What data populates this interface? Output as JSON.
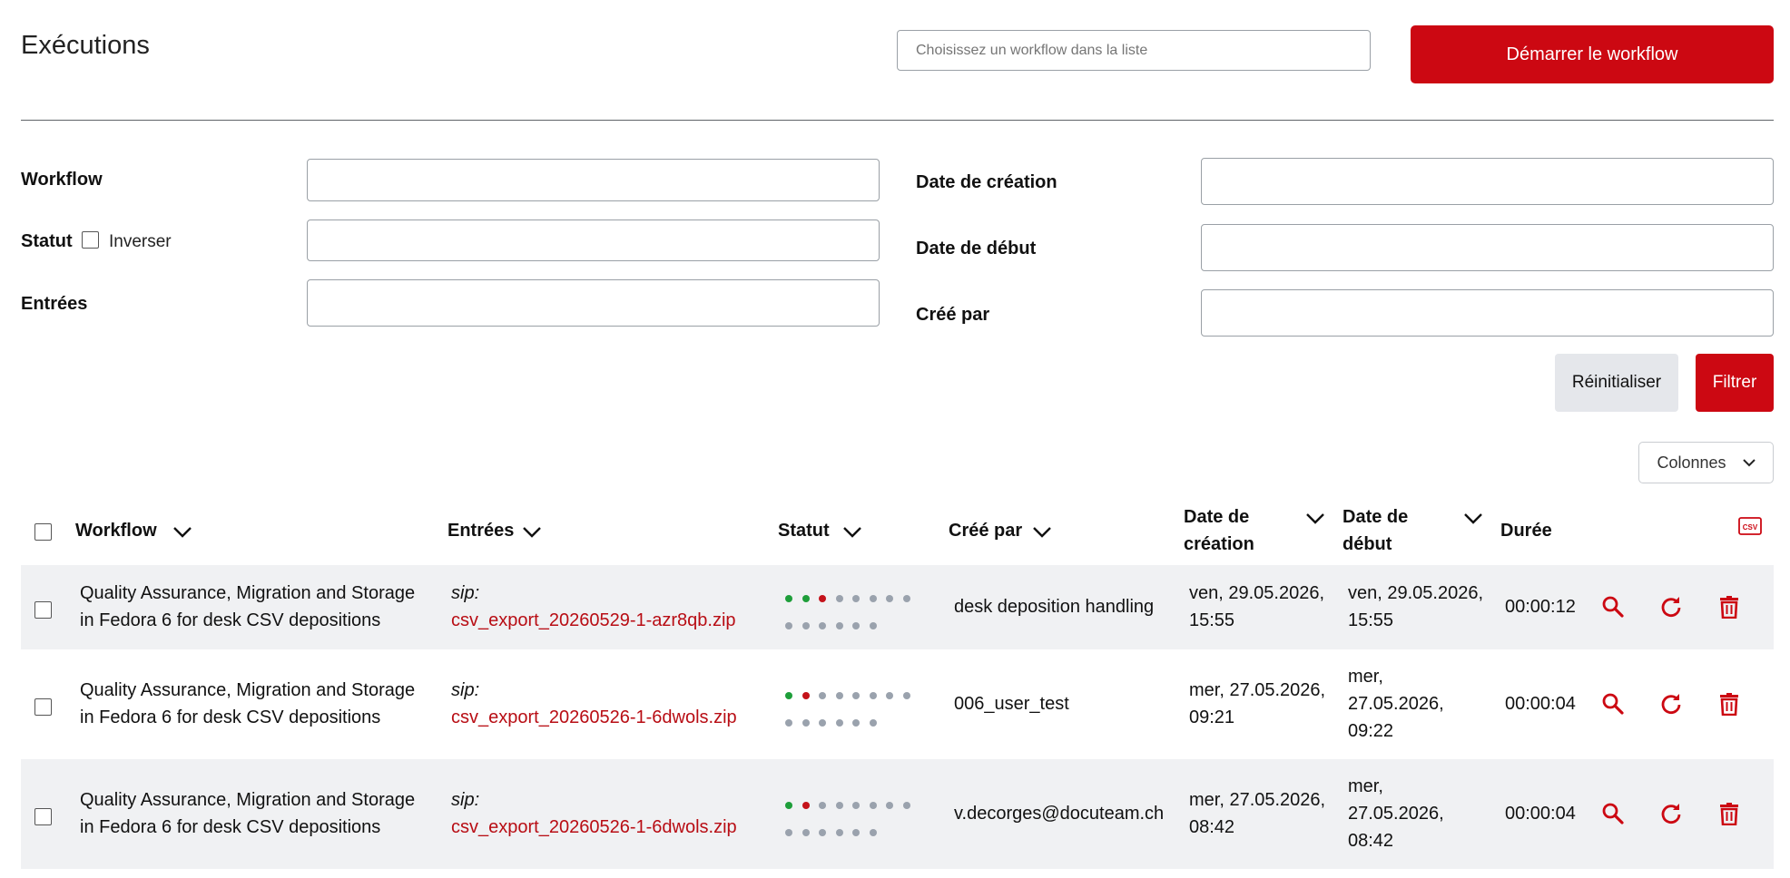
{
  "header": {
    "title": "Exécutions",
    "workflow_select_placeholder": "Choisissez un workflow dans la liste",
    "start_button": "Démarrer le workflow"
  },
  "filters": {
    "workflow_label": "Workflow",
    "status_label": "Statut",
    "invert_label": "Inverser",
    "inputs_label": "Entrées",
    "created_date_label": "Date de création",
    "start_date_label": "Date de début",
    "created_by_label": "Créé par",
    "reset_button": "Réinitialiser",
    "filter_button": "Filtrer"
  },
  "columns_button": "Colonnes",
  "table": {
    "headers": {
      "workflow": "Workflow",
      "inputs": "Entrées",
      "status": "Statut",
      "created_by": "Créé par",
      "created_date_1": "Date de",
      "created_date_2": "création",
      "start_date_1": "Date de",
      "start_date_2": "début",
      "duration": "Durée"
    },
    "rows": [
      {
        "workflow_1": "Quality Assurance, Migration and Storage",
        "workflow_2": "in Fedora 6 for desk CSV depositions",
        "input_type": "sip:",
        "input_file": "csv_export_20260529-1-azr8qb.zip",
        "status_dots": [
          "green",
          "green",
          "red",
          "grey",
          "grey",
          "grey",
          "grey",
          "grey",
          "grey",
          "grey",
          "grey",
          "grey",
          "grey",
          "grey"
        ],
        "created_by": "desk deposition handling",
        "created_1": "ven, 29.05.2026,",
        "created_2": "15:55",
        "start_1": "ven, 29.05.2026,",
        "start_2": "15:55",
        "start_3": "",
        "duration": "00:00:12"
      },
      {
        "workflow_1": "Quality Assurance, Migration and Storage",
        "workflow_2": "in Fedora 6 for desk CSV depositions",
        "input_type": "sip:",
        "input_file": "csv_export_20260526-1-6dwols.zip",
        "status_dots": [
          "green",
          "red",
          "grey",
          "grey",
          "grey",
          "grey",
          "grey",
          "grey",
          "grey",
          "grey",
          "grey",
          "grey",
          "grey",
          "grey"
        ],
        "created_by": "006_user_test",
        "created_1": "mer, 27.05.2026,",
        "created_2": "09:21",
        "start_1": "mer,",
        "start_2": "27.05.2026,",
        "start_3": "09:22",
        "duration": "00:00:04"
      },
      {
        "workflow_1": "Quality Assurance, Migration and Storage",
        "workflow_2": "in Fedora 6 for desk CSV depositions",
        "input_type": "sip:",
        "input_file": "csv_export_20260526-1-6dwols.zip",
        "status_dots": [
          "green",
          "red",
          "grey",
          "grey",
          "grey",
          "grey",
          "grey",
          "grey",
          "grey",
          "grey",
          "grey",
          "grey",
          "grey",
          "grey"
        ],
        "created_by": "v.decorges@docuteam.ch",
        "created_1": "mer, 27.05.2026,",
        "created_2": "08:42",
        "start_1": "mer,",
        "start_2": "27.05.2026,",
        "start_3": "08:42",
        "duration": "00:00:04"
      }
    ]
  },
  "colors": {
    "accent": "#cc0812",
    "link": "#b80d14",
    "dot_green": "#1e9e3a",
    "dot_red": "#c4121a",
    "dot_grey": "#9aa2ad",
    "row_alt": "#f0f1f3"
  },
  "icons": [
    "chevron-down-icon",
    "csv-icon",
    "search-icon",
    "refresh-icon",
    "trash-icon"
  ]
}
